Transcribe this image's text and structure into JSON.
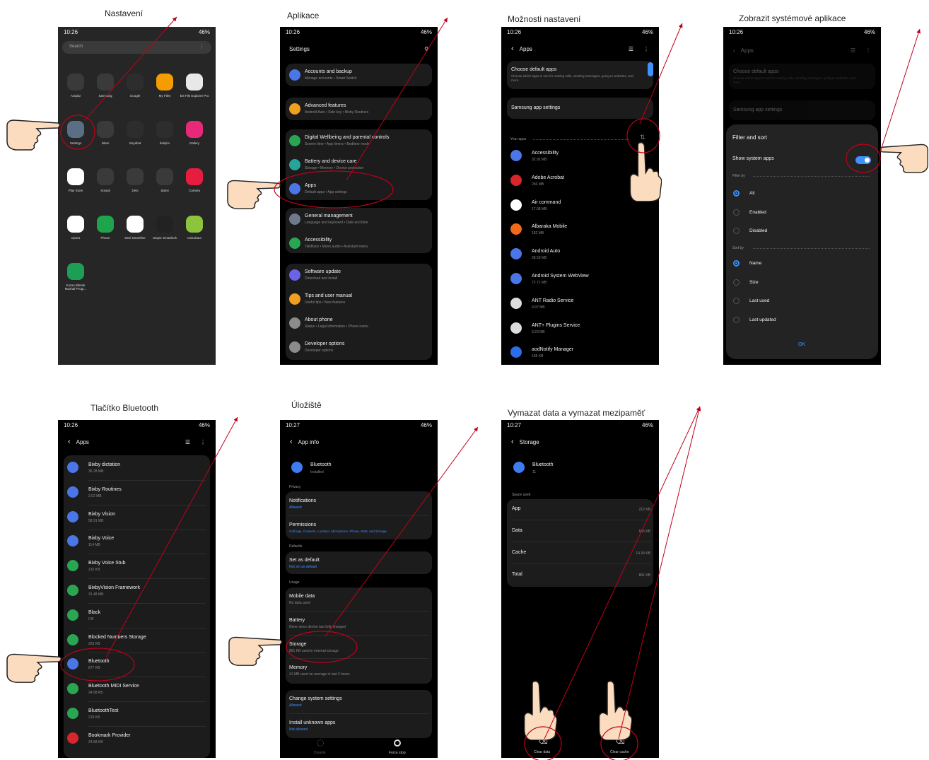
{
  "captions": [
    "Nastavení",
    "Aplikace",
    "Možnosti nastavení",
    "Zobrazit systémové aplikace",
    "Tlačítko Bluetooth",
    "Úložiště",
    "Vymazat data a vymazat mezipaměť"
  ],
  "status": {
    "time": "10:26",
    "time2": "10:27",
    "battery": "46%"
  },
  "p1": {
    "search": "Search",
    "apps": [
      [
        "Araçlar",
        "Samsung",
        "Google",
        "My Files",
        "ES File Explorer Pro"
      ],
      [
        "Settings",
        "İslam",
        "Seyahat",
        "İletişim",
        "Gallery"
      ],
      [
        "Play Store",
        "Sosyal",
        "Desi",
        "Şahsi",
        "Camera"
      ],
      [
        "Opera",
        "Phone",
        "Desi Smartline",
        "Utopic Smartlock",
        "Calculator"
      ],
      [
        "Kuran Bilmek Mushaf Progr..."
      ]
    ]
  },
  "p2": {
    "title": "Settings",
    "items": [
      {
        "t": "Accounts and backup",
        "s": "Manage accounts  •  Smart Switch"
      },
      {
        "t": "Advanced features",
        "s": "Android Auto  •  Side key  •  Bixby Routines"
      },
      {
        "t": "Digital Wellbeing and parental controls",
        "s": "Screen time  •  App timers  •  Bedtime mode"
      },
      {
        "t": "Battery and device care",
        "s": "Storage  •  Memory  •  Device protection"
      },
      {
        "t": "Apps",
        "s": "Default apps  •  App settings"
      },
      {
        "t": "General management",
        "s": "Language and keyboard  •  Date and time"
      },
      {
        "t": "Accessibility",
        "s": "TalkBack  •  Mono audio  •  Assistant menu"
      },
      {
        "t": "Software update",
        "s": "Download and install"
      },
      {
        "t": "Tips and user manual",
        "s": "Useful tips  •  New features"
      },
      {
        "t": "About phone",
        "s": "Status  •  Legal information  •  Phone name"
      },
      {
        "t": "Developer options",
        "s": "Developer options"
      }
    ]
  },
  "p3": {
    "back": "Apps",
    "default_t": "Choose default apps",
    "default_s": "Choose which apps to use for making calls, sending messages, going to websites, and more.",
    "samsung": "Samsung app settings",
    "your_apps": "Your apps",
    "apps": [
      {
        "t": "Accessibility",
        "s": "32.92 MB"
      },
      {
        "t": "Adobe Acrobat",
        "s": "266 MB"
      },
      {
        "t": "Air command",
        "s": "17.98 MB"
      },
      {
        "t": "Albaraka Mobile",
        "s": "182 MB"
      },
      {
        "t": "Android Auto",
        "s": "58.59 MB"
      },
      {
        "t": "Android System WebView",
        "s": "72.71 MB"
      },
      {
        "t": "ANT Radio Service",
        "s": "0.97 MB"
      },
      {
        "t": "ANT+ Plugins Service",
        "s": "3.23 MB"
      },
      {
        "t": "aodNotify Manager",
        "s": "158 KB"
      }
    ]
  },
  "p4": {
    "back": "Apps",
    "title": "Filter and sort",
    "show_sys": "Show system apps",
    "filter_by": "Filter by",
    "filters": [
      "All",
      "Enabled",
      "Disabled"
    ],
    "sort_by": "Sort by",
    "sorts": [
      "Name",
      "Size",
      "Last used",
      "Last updated"
    ],
    "ok": "OK"
  },
  "p5": {
    "back": "Apps",
    "apps": [
      {
        "t": "Bixby dictation",
        "s": "36.28 MB"
      },
      {
        "t": "Bixby Routines",
        "s": "2.02 MB"
      },
      {
        "t": "Bixby Vision",
        "s": "58.91 MB"
      },
      {
        "t": "Bixby Voice",
        "s": "114 MB"
      },
      {
        "t": "Bixby Voice Stub",
        "s": "215 KB"
      },
      {
        "t": "BixbyVision Framework",
        "s": "31.48 MB"
      },
      {
        "t": "Black",
        "s": "0 B"
      },
      {
        "t": "Blocked Numbers Storage",
        "s": "253 KB"
      },
      {
        "t": "Bluetooth",
        "s": "877 KB"
      },
      {
        "t": "Bluetooth MIDI Service",
        "s": "24.58 KB"
      },
      {
        "t": "BluetoothTest",
        "s": "219 KB"
      },
      {
        "t": "Bookmark Provider",
        "s": "24.58 KB"
      }
    ]
  },
  "p6": {
    "back": "App info",
    "app": "Bluetooth",
    "installed": "Installed",
    "privacy": "Privacy",
    "notif_t": "Notifications",
    "notif_s": "Allowed",
    "perm_t": "Permissions",
    "perm_s": "Call logs, Contacts, Location, Microphone, Phone, SMS, and Storage",
    "defaults": "Defaults",
    "def_t": "Set as default",
    "def_s": "Not set as default",
    "usage": "Usage",
    "mob_t": "Mobile data",
    "mob_s": "No data used",
    "bat_t": "Battery",
    "bat_s": "None since device last fully charged",
    "sto_t": "Storage",
    "sto_s": "891 KB used in internal storage",
    "mem_t": "Memory",
    "mem_s": "41 MB used on average in last 3 hours",
    "chg_t": "Change system settings",
    "chg_s": "Allowed",
    "inst_t": "Install unknown apps",
    "inst_s": "Not allowed",
    "disable": "Disable",
    "force": "Force stop"
  },
  "p7": {
    "back": "Storage",
    "app": "Bluetooth",
    "version": "11",
    "space": "Space used",
    "rows": [
      {
        "t": "App",
        "v": "212 KB"
      },
      {
        "t": "Data",
        "v": "665 KB"
      },
      {
        "t": "Cache",
        "v": "14.34 KB"
      },
      {
        "t": "Total",
        "v": "891 KB"
      }
    ],
    "clear_data": "Clear data",
    "clear_cache": "Clear cache"
  },
  "colors": {
    "accent": "#3e91ff",
    "annotation": "#c0001a"
  }
}
